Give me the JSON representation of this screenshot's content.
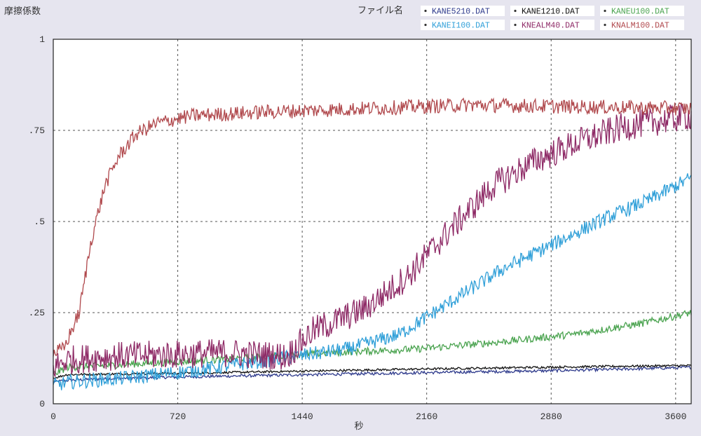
{
  "chart_data": {
    "type": "line",
    "ylabel": "摩擦係数",
    "xlabel": "秒",
    "legend_title": "ファイル名",
    "legend_placement": "top-right",
    "grid": true,
    "xlim": [
      0,
      3690
    ],
    "ylim": [
      0,
      1
    ],
    "xticks": [
      {
        "value": 0,
        "label": "0"
      },
      {
        "value": 720,
        "label": "720"
      },
      {
        "value": 1440,
        "label": "1440"
      },
      {
        "value": 2160,
        "label": "2160"
      },
      {
        "value": 2880,
        "label": "2880"
      },
      {
        "value": 3600,
        "label": "3600"
      }
    ],
    "yticks": [
      {
        "value": 0,
        "label": "0"
      },
      {
        "value": 0.25,
        "label": ".25"
      },
      {
        "value": 0.5,
        "label": ".5"
      },
      {
        "value": 0.75,
        "label": ".75"
      },
      {
        "value": 1,
        "label": "1"
      }
    ],
    "series": [
      {
        "name": "KANE5210.DAT",
        "color": "#2e3a8c",
        "noise": 0.004,
        "points": [
          [
            0,
            0.06
          ],
          [
            100,
            0.065
          ],
          [
            400,
            0.07
          ],
          [
            900,
            0.075
          ],
          [
            1500,
            0.08
          ],
          [
            2100,
            0.085
          ],
          [
            2800,
            0.09
          ],
          [
            3300,
            0.095
          ],
          [
            3690,
            0.1
          ]
        ]
      },
      {
        "name": "KANE1210.DAT",
        "color": "#111111",
        "noise": 0.003,
        "points": [
          [
            0,
            0.07
          ],
          [
            80,
            0.08
          ],
          [
            400,
            0.082
          ],
          [
            900,
            0.085
          ],
          [
            1500,
            0.09
          ],
          [
            2100,
            0.095
          ],
          [
            2800,
            0.1
          ],
          [
            3300,
            0.103
          ],
          [
            3690,
            0.105
          ]
        ]
      },
      {
        "name": "KANEU100.DAT",
        "color": "#4aa34f",
        "noise": 0.01,
        "points": [
          [
            0,
            0.08
          ],
          [
            80,
            0.1
          ],
          [
            300,
            0.105
          ],
          [
            700,
            0.115
          ],
          [
            1100,
            0.125
          ],
          [
            1600,
            0.14
          ],
          [
            2100,
            0.15
          ],
          [
            2600,
            0.17
          ],
          [
            3000,
            0.19
          ],
          [
            3400,
            0.22
          ],
          [
            3690,
            0.25
          ]
        ]
      },
      {
        "name": "KANEI100.DAT",
        "color": "#2f9fd8",
        "noise": 0.02,
        "points": [
          [
            0,
            0.05
          ],
          [
            100,
            0.06
          ],
          [
            400,
            0.07
          ],
          [
            800,
            0.09
          ],
          [
            1100,
            0.11
          ],
          [
            1400,
            0.13
          ],
          [
            1700,
            0.15
          ],
          [
            2000,
            0.19
          ],
          [
            2300,
            0.28
          ],
          [
            2600,
            0.37
          ],
          [
            2900,
            0.44
          ],
          [
            3200,
            0.51
          ],
          [
            3450,
            0.56
          ],
          [
            3690,
            0.62
          ]
        ]
      },
      {
        "name": "KNEALM40.DAT",
        "color": "#8e2a66",
        "noise": 0.04,
        "points": [
          [
            0,
            0.1
          ],
          [
            80,
            0.12
          ],
          [
            300,
            0.13
          ],
          [
            700,
            0.135
          ],
          [
            1000,
            0.14
          ],
          [
            1350,
            0.13
          ],
          [
            1500,
            0.2
          ],
          [
            1800,
            0.26
          ],
          [
            2050,
            0.35
          ],
          [
            2300,
            0.48
          ],
          [
            2550,
            0.6
          ],
          [
            2800,
            0.67
          ],
          [
            3050,
            0.72
          ],
          [
            3300,
            0.76
          ],
          [
            3690,
            0.79
          ]
        ]
      },
      {
        "name": "KNALM100.DAT",
        "color": "#b0484c",
        "noise": 0.02,
        "points": [
          [
            0,
            0.14
          ],
          [
            60,
            0.15
          ],
          [
            150,
            0.25
          ],
          [
            220,
            0.45
          ],
          [
            300,
            0.6
          ],
          [
            380,
            0.68
          ],
          [
            480,
            0.74
          ],
          [
            600,
            0.77
          ],
          [
            800,
            0.79
          ],
          [
            1200,
            0.8
          ],
          [
            1800,
            0.81
          ],
          [
            2400,
            0.82
          ],
          [
            3000,
            0.815
          ],
          [
            3690,
            0.81
          ]
        ]
      }
    ]
  }
}
